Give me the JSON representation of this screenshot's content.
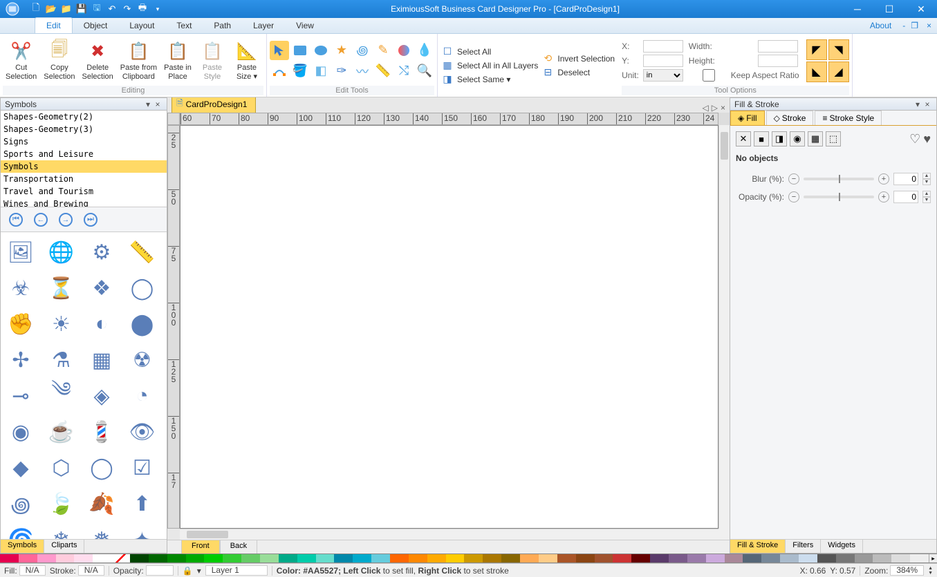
{
  "app": {
    "title": "EximiousSoft Business Card Designer Pro - [CardProDesign1]",
    "about": "About"
  },
  "tabs": {
    "edit": "Edit",
    "object": "Object",
    "layout": "Layout",
    "text": "Text",
    "path": "Path",
    "layer": "Layer",
    "view": "View"
  },
  "ribbon": {
    "editing": {
      "cut": "Cut\nSelection",
      "copy": "Copy\nSelection",
      "delete": "Delete\nSelection",
      "pasteFrom": "Paste from\nClipboard",
      "pasteIn": "Paste in\nPlace",
      "pasteStyle": "Paste\nStyle",
      "pasteSize": "Paste\nSize ▾",
      "label": "Editing"
    },
    "editTools": {
      "label": "Edit Tools"
    },
    "selection": {
      "selectAll": "Select All",
      "selectAllLayers": "Select All in All Layers",
      "selectSame": "Select Same ▾",
      "invert": "Invert Selection",
      "deselect": "Deselect"
    },
    "tooloptions": {
      "x": "X:",
      "y": "Y:",
      "unit": "Unit:",
      "unitVal": "in",
      "width": "Width:",
      "height": "Height:",
      "aspect": "Keep Aspect Ratio",
      "label": "Tool Options"
    }
  },
  "symbolsPanel": {
    "title": "Symbols",
    "categories": [
      "Shapes-Geometry(2)",
      "Shapes-Geometry(3)",
      "Signs",
      "Sports and Leisure",
      "Symbols",
      "Transportation",
      "Travel and Tourism",
      "Wines and Brewing"
    ],
    "selected": 4,
    "tabs": {
      "symbols": "Symbols",
      "cliparts": "Cliparts"
    }
  },
  "document": {
    "tabName": "CardProDesign1",
    "hticks": [
      "60",
      "70",
      "80",
      "90",
      "100",
      "110",
      "120",
      "130",
      "140",
      "150",
      "160",
      "170",
      "180",
      "190",
      "200",
      "210",
      "220",
      "230",
      "24"
    ],
    "vticks": [
      "25",
      "50",
      "75",
      "100",
      "125",
      "150",
      "17"
    ],
    "front": "Front",
    "back": "Back"
  },
  "fillStroke": {
    "title": "Fill & Stroke",
    "tabFill": "Fill",
    "tabStroke": "Stroke",
    "tabStrokeStyle": "Stroke Style",
    "noObjects": "No objects",
    "blur": "Blur (%):",
    "blurVal": "0",
    "opacity": "Opacity (%):",
    "opacityVal": "0",
    "bottomTabs": {
      "fillStroke": "Fill & Stroke",
      "filters": "Filters",
      "widgets": "Widgets"
    }
  },
  "palette": [
    "#e5004f",
    "#ff6699",
    "#ff99cc",
    "#ffccdd",
    "#ffddee",
    "#ffffff",
    "",
    "#004400",
    "#006600",
    "#008800",
    "#00aa00",
    "#00cc00",
    "#33cc33",
    "#66cc66",
    "#99dd99",
    "#00aa88",
    "#00ccaa",
    "#66ddcc",
    "#0088aa",
    "#00aacc",
    "#66ccdd",
    "#ff6600",
    "#ff8800",
    "#ffaa00",
    "#ffcc00",
    "#cc9900",
    "#aa7700",
    "#886600",
    "#ffaa55",
    "#ffcc88",
    "#aa5527",
    "#8b4513",
    "#a0522d",
    "#cc3333",
    "#660000",
    "#5a3a6a",
    "#7a5a8a",
    "#9a7aaa",
    "#ccaadd",
    "#aa8899",
    "#556677",
    "#778899",
    "#aabbcc",
    "#ccddee",
    "#555555",
    "#777777",
    "#999999",
    "#bbbbbb",
    "#dddddd",
    "#eeeeee"
  ],
  "status": {
    "fill": "Fill:",
    "fillVal": "N/A",
    "stroke": "Stroke:",
    "strokeVal": "N/A",
    "opacity2": "Opacity:",
    "layer": "Layer 1",
    "hint": "Color: #AA5527; Left Click to set fill, Right Click to set stroke",
    "x": "X:",
    "xVal": "0.66",
    "y": "Y:",
    "yVal": "0.57",
    "zoom": "Zoom:",
    "zoomVal": "384%"
  }
}
